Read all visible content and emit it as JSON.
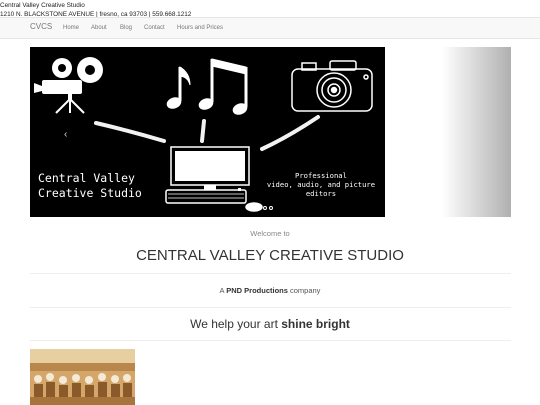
{
  "header": {
    "studio_name": "Central Valley Creative Studio",
    "address": "1210 N. BLACKSTONE AVENUE | fresno, ca 93703 | 559.668.1212"
  },
  "nav": {
    "brand": "CVCS",
    "items": [
      "Home",
      "About",
      "Blog",
      "Contact",
      "Hours and Prices"
    ]
  },
  "carousel": {
    "slide_title_line1": "Central Valley",
    "slide_title_line2": "Creative Studio",
    "slide_caption_line1": "Professional",
    "slide_caption_line2": "video, audio, and picture",
    "slide_caption_line3": "editors",
    "prev_symbol": "‹",
    "next_symbol": "›",
    "slide_count": 3,
    "active_slide": 1
  },
  "main": {
    "welcome": "Welcome to",
    "title": "CENTRAL VALLEY CREATIVE STUDIO",
    "company_prefix": "A",
    "company_name": "PND Productions",
    "company_suffix": "company",
    "tagline_prefix": "We help your art",
    "tagline_emphasis": "shine bright"
  },
  "colors": {
    "navbar_bg": "#f8f8f8",
    "slide_bg": "#000000",
    "text": "#333333"
  }
}
